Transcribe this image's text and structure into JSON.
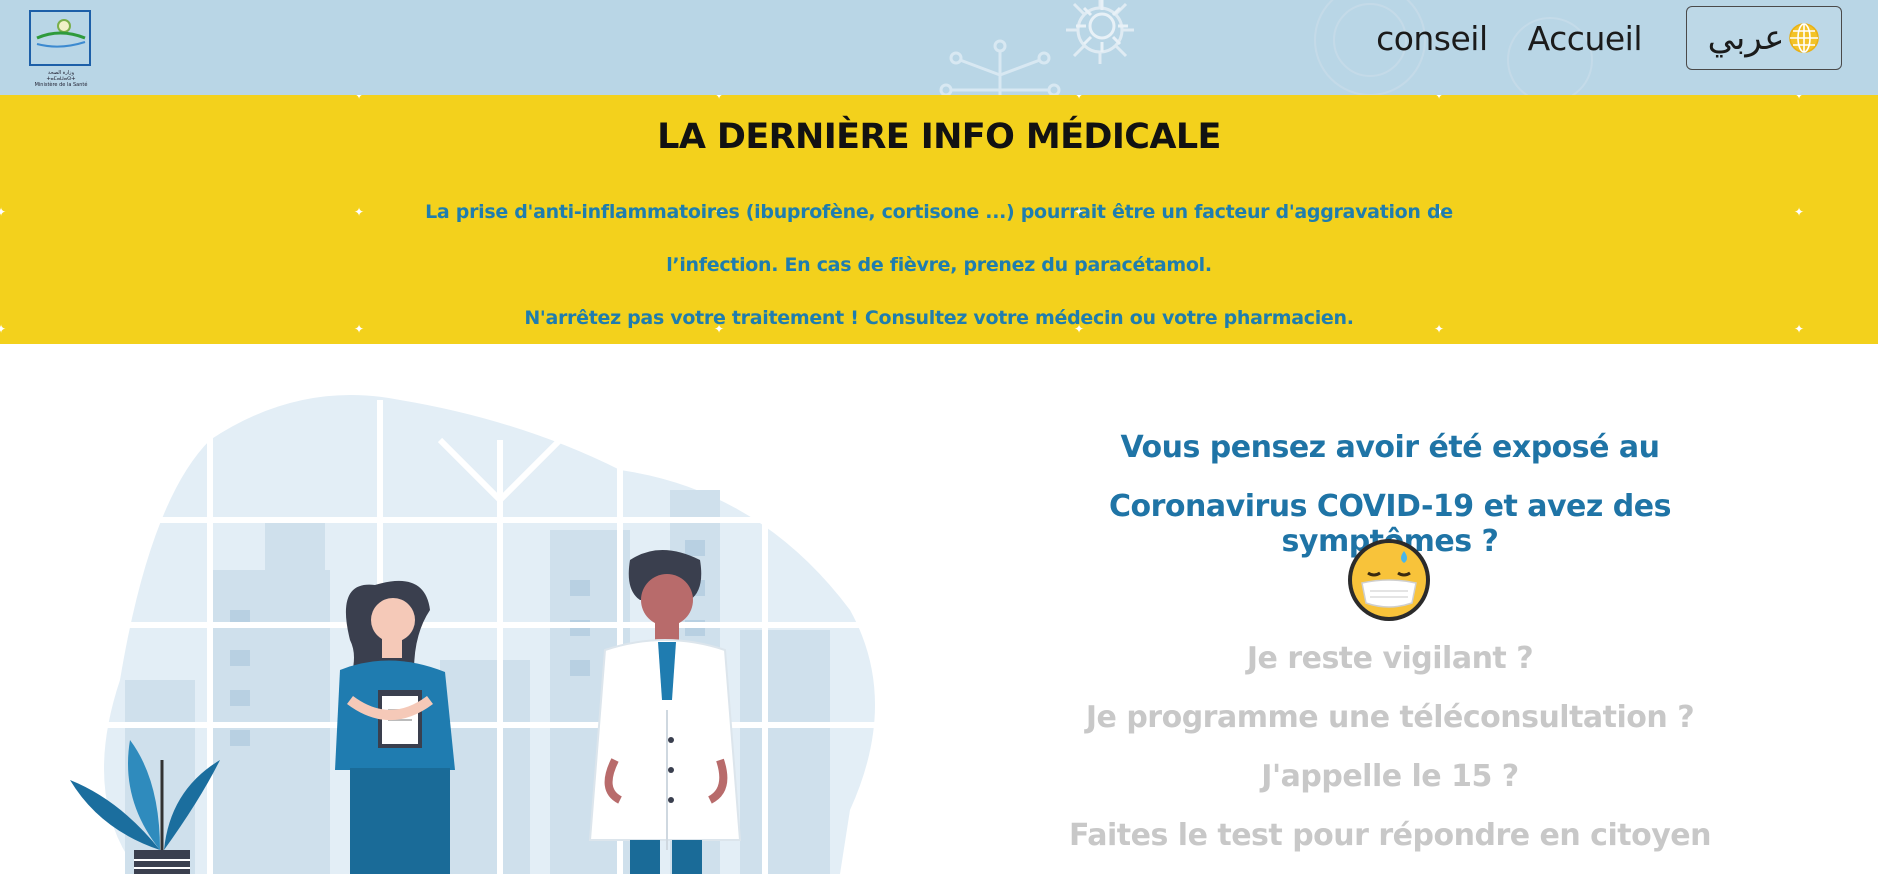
{
  "header": {
    "logo_name": "ministry-logo",
    "logo_text": [
      "وزارة الصحة",
      "ⵜⴰⵎⴰⵡⴰⵙⵜ",
      "Ministère de la Santé"
    ],
    "nav": {
      "link1": "conseil",
      "link2": "Accueil",
      "lang_label": "عربي",
      "lang_icon": "globe-icon"
    }
  },
  "banner": {
    "title": "LA DERNIÈRE INFO MÉDICALE",
    "line1": "La prise d'anti-inflammatoires (ibuprofène, cortisone ...) pourrait être un facteur d'aggravation de",
    "line2": "l’infection. En cas de fièvre, prenez du paracétamol.",
    "line3": "N'arrêtez pas votre traitement ! Consultez votre médecin ou votre pharmacien."
  },
  "main": {
    "question_line1": "Vous pensez avoir été exposé au",
    "question_line2": "Coronavirus COVID-19 et avez des symptômes ?",
    "emoji_icon": "masked-face-emoji-icon",
    "options": [
      "Je reste vigilant ?",
      "Je programme une téléconsultation ?",
      "J'appelle le 15 ?",
      "Faites le test pour répondre en citoyen"
    ]
  },
  "colors": {
    "header_bg": "#b9d6e6",
    "banner_bg": "#f3d11c",
    "accent_blue": "#1f74a6",
    "option_gray": "#c8c8c8"
  }
}
